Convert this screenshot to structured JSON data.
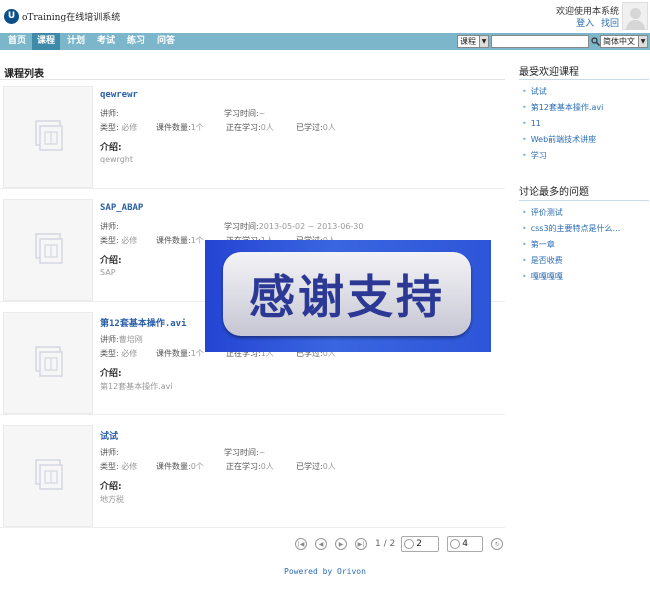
{
  "header": {
    "logo": "U",
    "site_title": "oTraining在线培训系统",
    "welcome": "欢迎使用本系统",
    "login": "登入",
    "find": "找回"
  },
  "nav": {
    "items": [
      "首页",
      "课程",
      "计划",
      "考试",
      "练习",
      "问答"
    ],
    "active": "课程",
    "search_type": "课程",
    "search_value": "",
    "language": "简体中文"
  },
  "main": {
    "title": "课程列表",
    "labels": {
      "teacher": "讲师:",
      "study_time": "学习时间:",
      "type": "类型:",
      "count": "课件数量:",
      "studying": "正在学习:",
      "learned": "已学过:",
      "intro": "介绍:"
    },
    "courses": [
      {
        "title": "qewrewr",
        "teacher": "",
        "time": "~",
        "type": "必修",
        "count": "1个",
        "studying": "0人",
        "learned": "0人",
        "desc": "qewrght"
      },
      {
        "title": "SAP_ABAP",
        "teacher": "",
        "time": "2013-05-02 ~ 2013-06-30",
        "type": "必修",
        "count": "1个",
        "studying": "1人",
        "learned": "0人",
        "desc": "SAP"
      },
      {
        "title": "第12套基本操作.avi",
        "teacher": "曹培刚",
        "time": "",
        "type": "必修",
        "count": "1个",
        "studying": "1人",
        "learned": "0人",
        "desc": "第12套基本操作.avi"
      },
      {
        "title": "试试",
        "teacher": "",
        "time": "~",
        "type": "必修",
        "count": "0个",
        "studying": "0人",
        "learned": "0人",
        "desc": "地方税"
      }
    ]
  },
  "overlay": {
    "text": "感谢支持"
  },
  "pager": {
    "page_info": "1 / 2",
    "jump_value": "2",
    "page_size": "4"
  },
  "footer": {
    "powered": "Powered by Orivon"
  },
  "sidebar": {
    "popular_title": "最受欢迎课程",
    "popular": [
      "试试",
      "第12套基本操作.avi",
      "11",
      "Web前端技术讲座",
      "学习"
    ],
    "discussed_title": "讨论最多的问题",
    "discussed": [
      "评价测试",
      "css3的主要特点是什么...",
      "第一章",
      "是否收费",
      "嘎嘎嘎嘎"
    ]
  }
}
